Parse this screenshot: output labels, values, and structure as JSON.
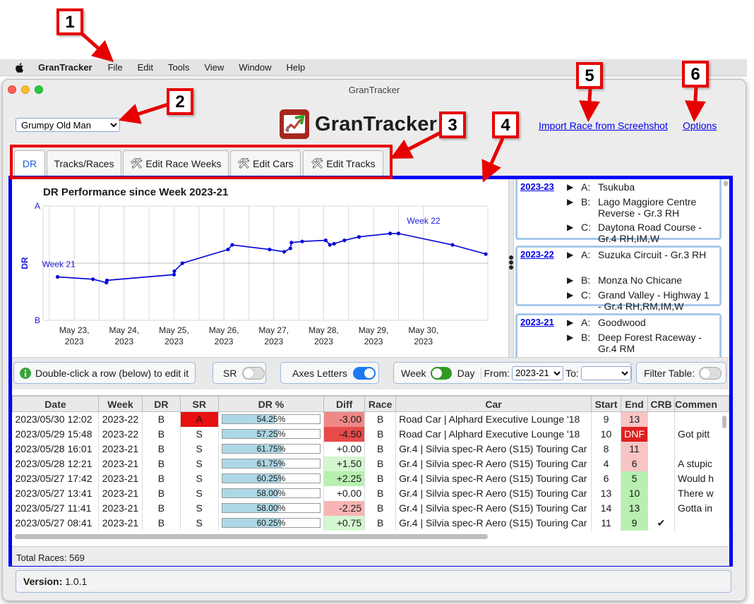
{
  "menubar": {
    "app_name": "GranTracker",
    "items": [
      "File",
      "Edit",
      "Tools",
      "View",
      "Window",
      "Help"
    ]
  },
  "window": {
    "title": "GranTracker"
  },
  "profile": {
    "selected": "Grumpy Old Man"
  },
  "logo": {
    "text": "GranTracker"
  },
  "links": {
    "import": "Import Race from Screehshot",
    "options": "Options"
  },
  "tabs": [
    {
      "label": "DR",
      "icon": ""
    },
    {
      "label": "Tracks/Races",
      "icon": ""
    },
    {
      "label": "Edit Race Weeks",
      "icon": "tools-icon"
    },
    {
      "label": "Edit Cars",
      "icon": "tools-icon"
    },
    {
      "label": "Edit Tracks",
      "icon": "tools-icon"
    }
  ],
  "callouts": [
    "1",
    "2",
    "3",
    "4",
    "5",
    "6"
  ],
  "chart_data": {
    "type": "line",
    "title": "DR Performance since Week 2023-21",
    "ylabel": "DR",
    "y_ticks": [
      "A",
      "B"
    ],
    "x_ticks": [
      [
        "May 23,",
        "2023"
      ],
      [
        "May 24,",
        "2023"
      ],
      [
        "May 25,",
        "2023"
      ],
      [
        "May 26,",
        "2023"
      ],
      [
        "May 27,",
        "2023"
      ],
      [
        "May 28,",
        "2023"
      ],
      [
        "May 29,",
        "2023"
      ],
      [
        "May 30,",
        "2023"
      ]
    ],
    "annotations": [
      "Week 21",
      "Week 22"
    ],
    "series": [
      {
        "color": "#0000d8",
        "points": [
          [
            "2023-05-22 16:00",
            0.38
          ],
          [
            "2023-05-23 09:00",
            0.36
          ],
          [
            "2023-05-23 15:30",
            0.33
          ],
          [
            "2023-05-23 15:45",
            0.35
          ],
          [
            "2023-05-25 00:00",
            0.4
          ],
          [
            "2023-05-25 00:10",
            0.43
          ],
          [
            "2023-05-25 04:00",
            0.5
          ],
          [
            "2023-05-26 02:00",
            0.62
          ],
          [
            "2023-05-26 04:00",
            0.66
          ],
          [
            "2023-05-26 22:00",
            0.62
          ],
          [
            "2023-05-27 05:00",
            0.6
          ],
          [
            "2023-05-27 08:00",
            0.63
          ],
          [
            "2023-05-27 08:30",
            0.68
          ],
          [
            "2023-05-27 13:41",
            0.69
          ],
          [
            "2023-05-28 01:00",
            0.7
          ],
          [
            "2023-05-28 03:00",
            0.66
          ],
          [
            "2023-05-28 05:00",
            0.67
          ],
          [
            "2023-05-28 10:00",
            0.7
          ],
          [
            "2023-05-28 17:00",
            0.73
          ],
          [
            "2023-05-29 08:00",
            0.76
          ],
          [
            "2023-05-29 12:00",
            0.76
          ],
          [
            "2023-05-30 14:00",
            0.66
          ],
          [
            "2023-05-31 06:00",
            0.58
          ]
        ]
      }
    ],
    "grid": true
  },
  "weeks": [
    {
      "id": "2023-23",
      "tracks": [
        {
          "letter": "A:",
          "name": "Tsukuba"
        },
        {
          "letter": "B:",
          "name": "Lago Maggiore Centre Reverse - Gr.3 RH"
        },
        {
          "letter": "C:",
          "name": "Daytona Road Course - Gr.4 RH,IM,W"
        }
      ]
    },
    {
      "id": "2023-22",
      "tracks": [
        {
          "letter": "A:",
          "name": "Suzuka Circuit - Gr.3 RH"
        },
        {
          "letter": "B:",
          "name": "Monza No Chicane"
        },
        {
          "letter": "C:",
          "name": "Grand Valley - Highway 1 - Gr.4 RH,RM,IM,W"
        }
      ]
    },
    {
      "id": "2023-21",
      "tracks": [
        {
          "letter": "A:",
          "name": "Goodwood"
        },
        {
          "letter": "B:",
          "name": "Deep Forest Raceway - Gr.4 RM"
        }
      ]
    }
  ],
  "toolbar": {
    "hint": "Double-click a row (below) to edit it",
    "sr_label": "SR",
    "axes_label": "Axes Letters",
    "week_label": "Week",
    "day_label": "Day",
    "from_label": "From:",
    "from_value": "2023-21",
    "to_label": "To:",
    "to_value": "",
    "filter_label": "Filter Table:"
  },
  "table": {
    "columns": [
      "Date",
      "Week",
      "DR",
      "SR",
      "DR %",
      "Diff",
      "Race",
      "Car",
      "Start",
      "End",
      "CRB",
      "Commen"
    ],
    "rows": [
      {
        "date": "2023/05/30 12:02",
        "week": "2023-22",
        "dr": "B",
        "sr": "A",
        "drpct": "54.25%",
        "pct": 0.5425,
        "diff": "-3.00",
        "race": "B",
        "car": "Road Car | Alphard Executive Lounge '18",
        "start": "9",
        "end": "13",
        "crb": "",
        "comment": ""
      },
      {
        "date": "2023/05/29 15:48",
        "week": "2023-22",
        "dr": "B",
        "sr": "S",
        "drpct": "57.25%",
        "pct": 0.5725,
        "diff": "-4.50",
        "race": "B",
        "car": "Road Car | Alphard Executive Lounge '18",
        "start": "10",
        "end": "DNF",
        "crb": "",
        "comment": "Got pitt"
      },
      {
        "date": "2023/05/28 16:01",
        "week": "2023-21",
        "dr": "B",
        "sr": "S",
        "drpct": "61.75%",
        "pct": 0.6175,
        "diff": "+0.00",
        "race": "B",
        "car": "Gr.4 | Silvia spec-R Aero (S15) Touring Car",
        "start": "8",
        "end": "11",
        "crb": "",
        "comment": ""
      },
      {
        "date": "2023/05/28 12:21",
        "week": "2023-21",
        "dr": "B",
        "sr": "S",
        "drpct": "61.75%",
        "pct": 0.6175,
        "diff": "+1.50",
        "race": "B",
        "car": "Gr.4 | Silvia spec-R Aero (S15) Touring Car",
        "start": "4",
        "end": "6",
        "crb": "",
        "comment": "A stupic"
      },
      {
        "date": "2023/05/27 17:42",
        "week": "2023-21",
        "dr": "B",
        "sr": "S",
        "drpct": "60.25%",
        "pct": 0.6025,
        "diff": "+2.25",
        "race": "B",
        "car": "Gr.4 | Silvia spec-R Aero (S15) Touring Car",
        "start": "6",
        "end": "5",
        "crb": "",
        "comment": "Would h"
      },
      {
        "date": "2023/05/27 13:41",
        "week": "2023-21",
        "dr": "B",
        "sr": "S",
        "drpct": "58.00%",
        "pct": 0.58,
        "diff": "+0.00",
        "race": "B",
        "car": "Gr.4 | Silvia spec-R Aero (S15) Touring Car",
        "start": "13",
        "end": "10",
        "crb": "",
        "comment": "There w"
      },
      {
        "date": "2023/05/27 11:41",
        "week": "2023-21",
        "dr": "B",
        "sr": "S",
        "drpct": "58.00%",
        "pct": 0.58,
        "diff": "-2.25",
        "race": "B",
        "car": "Gr.4 | Silvia spec-R Aero (S15) Touring Car",
        "start": "14",
        "end": "13",
        "crb": "",
        "comment": "Gotta in"
      },
      {
        "date": "2023/05/27 08:41",
        "week": "2023-21",
        "dr": "B",
        "sr": "S",
        "drpct": "60.25%",
        "pct": 0.6025,
        "diff": "+0.75",
        "race": "B",
        "car": "Gr.4 | Silvia spec-R Aero (S15) Touring Car",
        "start": "11",
        "end": "9",
        "crb": "✔",
        "comment": ""
      }
    ]
  },
  "footer": {
    "total": "Total Races: 569"
  },
  "version": {
    "label": "Version:",
    "value": "1.0.1"
  },
  "colors": {
    "accent": "#0000f5",
    "callout": "#e60000",
    "link": "#0000ee"
  }
}
